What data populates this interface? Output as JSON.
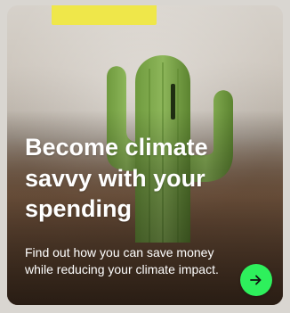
{
  "card": {
    "headline": "Become climate savvy with your spending",
    "subtext": "Find out how you can save money while reducing your climate impact.",
    "cta_icon": "arrow-right-icon",
    "cta_color": "#2ef05c",
    "tag_color": "#efe74a",
    "image_subject": "cactus"
  }
}
